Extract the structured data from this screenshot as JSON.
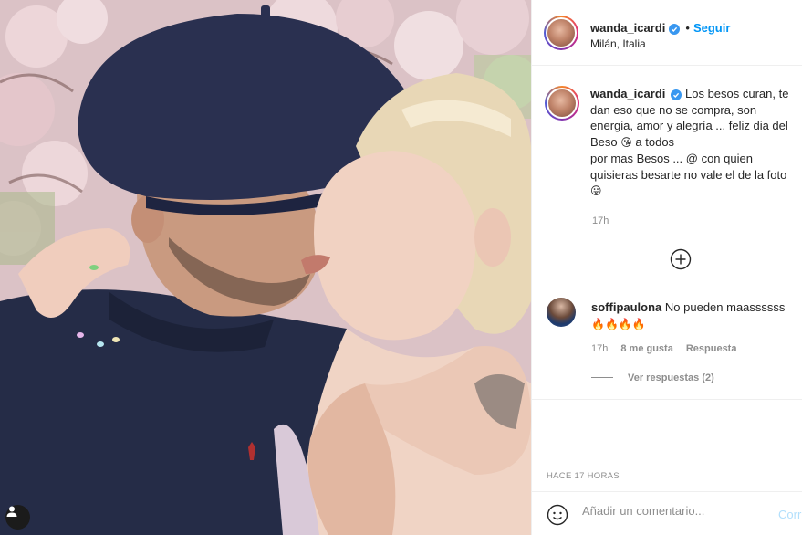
{
  "header": {
    "username": "wanda_icardi",
    "separator": "•",
    "follow_label": "Seguir",
    "location": "Milán, Italia"
  },
  "caption": {
    "username": "wanda_icardi",
    "line1": "Los besos curan, te dan eso que no se compra, son energia, amor y alegría ... feliz dia del Beso",
    "emoji1": "😘",
    "line1b": "a todos",
    "line2": "por mas Besos ... @ con quien quisieras besarte no vale el de la foto",
    "emoji2": "😛",
    "time": "17h"
  },
  "comment": {
    "username": "soffipaulona",
    "text": "No pueden maassssss",
    "emojis": "🔥🔥🔥🔥",
    "time": "17h",
    "likes": "8 me gusta",
    "reply_label": "Respuesta",
    "view_replies": "Ver respuestas (2)"
  },
  "footer": {
    "time_ago": "HACE 17 HORAS",
    "comment_placeholder": "Añadir un comentario...",
    "post_label": "Corr"
  },
  "icons": {
    "verified": "verified-badge-icon",
    "plus": "plus-circle-icon",
    "heart": "heart-outline-icon",
    "emoji": "emoji-smile-icon",
    "user_tag": "user-tag-icon"
  },
  "colors": {
    "accent": "#0095f6",
    "verified": "#3897f0",
    "muted": "#8e8e8e",
    "text": "#262626"
  }
}
